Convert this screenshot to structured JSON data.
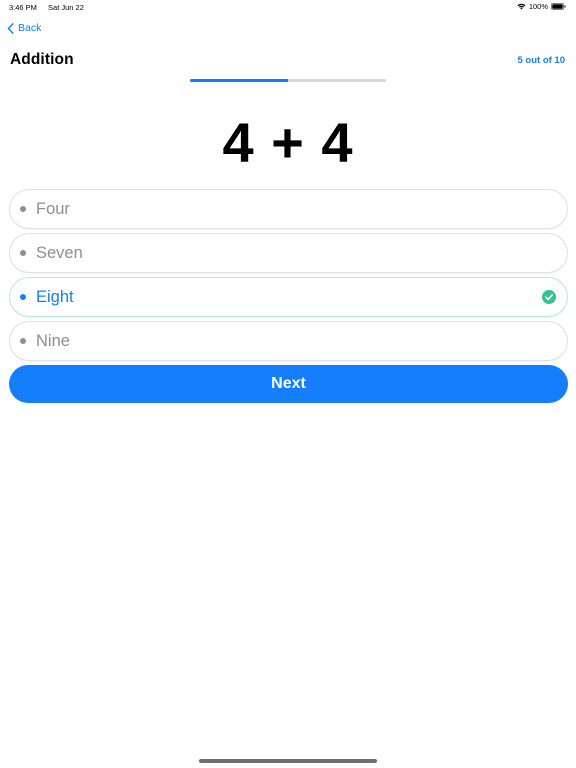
{
  "status_bar": {
    "time": "3:46 PM",
    "date": "Sat Jun 22",
    "battery": "100%"
  },
  "nav": {
    "back_label": "Back"
  },
  "header": {
    "title": "Addition",
    "progress_text": "5 out of 10",
    "progress_fraction": 0.5
  },
  "question": {
    "text": "4 + 4"
  },
  "options": [
    {
      "label": "Four",
      "selected": false
    },
    {
      "label": "Seven",
      "selected": false
    },
    {
      "label": "Eight",
      "selected": true,
      "correct": true
    },
    {
      "label": "Nine",
      "selected": false
    }
  ],
  "next_label": "Next",
  "colors": {
    "accent": "#147efb",
    "correct": "#34c38f",
    "muted": "#8e8e93"
  }
}
